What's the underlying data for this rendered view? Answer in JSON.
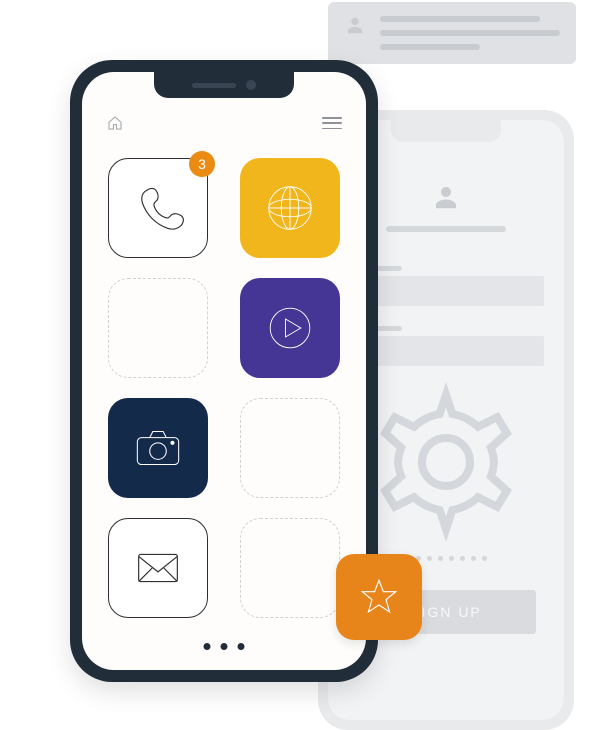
{
  "notification": {
    "icon": "person-icon"
  },
  "back_phone": {
    "profile_icon": "person-icon",
    "gear_icon": "gear-icon",
    "signup_label": "SIGN UP"
  },
  "front_phone": {
    "home_icon": "home-icon",
    "menu_icon": "menu-icon",
    "badge_count": "3",
    "tiles": [
      {
        "name": "phone-app",
        "icon": "phone-icon",
        "style": "outline",
        "badge": true
      },
      {
        "name": "globe-app",
        "icon": "globe-icon",
        "style": "yellow"
      },
      {
        "name": "empty-slot-1",
        "icon": null,
        "style": "dashed"
      },
      {
        "name": "video-app",
        "icon": "play-icon",
        "style": "indigo"
      },
      {
        "name": "camera-app",
        "icon": "camera-icon",
        "style": "navy"
      },
      {
        "name": "empty-slot-2",
        "icon": null,
        "style": "dashed"
      },
      {
        "name": "mail-app",
        "icon": "mail-icon",
        "style": "outline"
      },
      {
        "name": "empty-slot-3",
        "icon": null,
        "style": "dashed"
      }
    ],
    "pager_dots": 3
  },
  "floating_tile": {
    "name": "favorites-app",
    "icon": "star-icon"
  },
  "colors": {
    "frame": "#222d3a",
    "yellow": "#f1b61b",
    "indigo": "#453695",
    "navy": "#132a4a",
    "orange": "#e7841a",
    "badge": "#ea8b13",
    "gray_bg": "#e9eaec"
  }
}
